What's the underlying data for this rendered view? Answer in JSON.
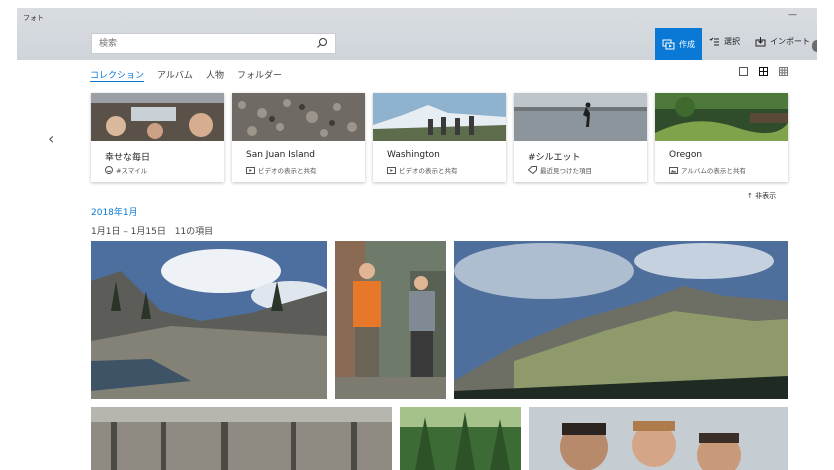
{
  "app": {
    "title": "フォト",
    "minimize": "—"
  },
  "search": {
    "placeholder": "検索"
  },
  "toolbar": {
    "create_label": "作成",
    "select_label": "選択",
    "import_label": "インポート"
  },
  "tabs": [
    {
      "label": "コレクション",
      "active": true
    },
    {
      "label": "アルバム"
    },
    {
      "label": "人物"
    },
    {
      "label": "フォルダー"
    }
  ],
  "albums": [
    {
      "title": "幸せな毎日",
      "subtitle": "#スマイル",
      "icon": "smile-icon"
    },
    {
      "title": "San Juan Island",
      "subtitle": "ビデオの表示と共有",
      "icon": "video-icon"
    },
    {
      "title": "Washington",
      "subtitle": "ビデオの表示と共有",
      "icon": "video-icon"
    },
    {
      "title": "#シルエット",
      "subtitle": "最近見つけた項目",
      "icon": "tag-icon"
    },
    {
      "title": "Oregon",
      "subtitle": "アルバムの表示と共有",
      "icon": "album-icon"
    }
  ],
  "collection": {
    "hide_label": "非表示",
    "heading": "2018年1月",
    "date_range": "1月1日 – 1月15日",
    "item_count": "11の項目"
  },
  "colors": {
    "accent": "#0a79d6"
  }
}
